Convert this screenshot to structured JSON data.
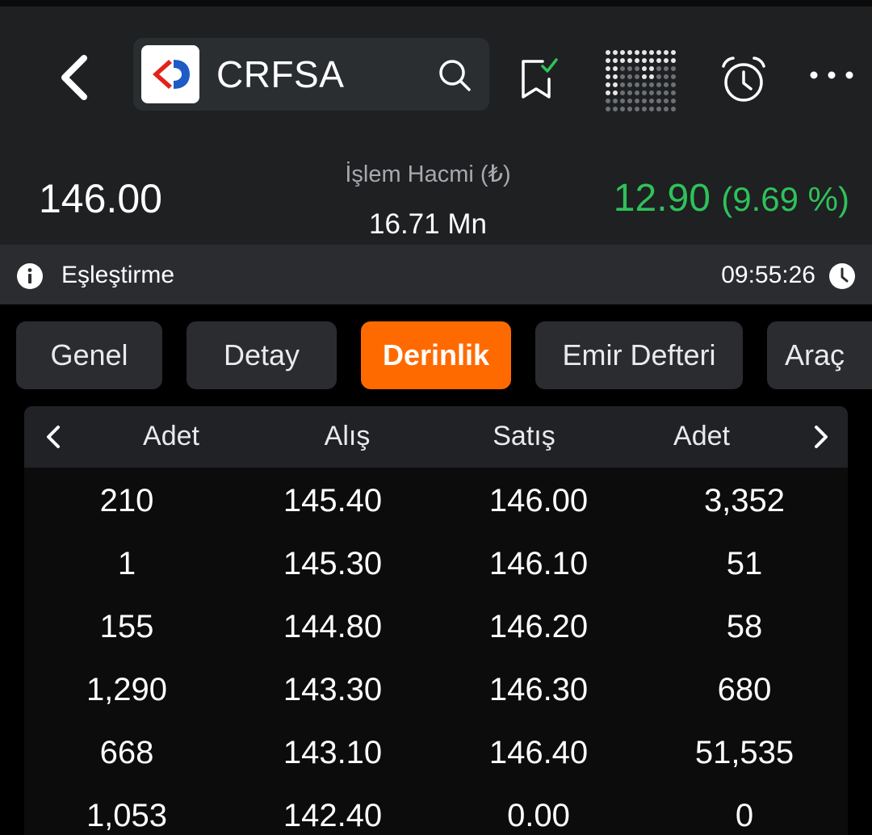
{
  "header": {
    "symbol": "CRFSA",
    "price": "146.00",
    "volume_label": "İşlem Hacmi (₺)",
    "volume_value": "16.71 Mn",
    "change_value": "12.90",
    "change_percent": "(9.69 %)"
  },
  "status": {
    "label": "Eşleştirme",
    "time": "09:55:26"
  },
  "tabs": [
    {
      "label": "Genel",
      "active": false
    },
    {
      "label": "Detay",
      "active": false
    },
    {
      "label": "Derinlik",
      "active": true
    },
    {
      "label": "Emir Defteri",
      "active": false
    },
    {
      "label": "Araç",
      "active": false
    }
  ],
  "depth": {
    "headers": [
      "Adet",
      "Alış",
      "Satış",
      "Adet"
    ],
    "rows": [
      [
        "210",
        "145.40",
        "146.00",
        "3,352"
      ],
      [
        "1",
        "145.30",
        "146.10",
        "51"
      ],
      [
        "155",
        "144.80",
        "146.20",
        "58"
      ],
      [
        "1,290",
        "143.30",
        "146.30",
        "680"
      ],
      [
        "668",
        "143.10",
        "146.40",
        "51,535"
      ],
      [
        "1,053",
        "142.40",
        "0.00",
        "0"
      ]
    ]
  },
  "colors": {
    "accent": "#ff6a00",
    "positive": "#2fc15a",
    "logo_red": "#e2231a",
    "logo_blue": "#1e5bc6"
  },
  "icons": [
    "back-arrow-icon",
    "carrefour-logo",
    "search-icon",
    "watchlist-icon",
    "market-depth-icon",
    "alarm-icon",
    "more-icon",
    "info-icon",
    "clock-icon",
    "chevron-left-icon",
    "chevron-right-icon"
  ]
}
